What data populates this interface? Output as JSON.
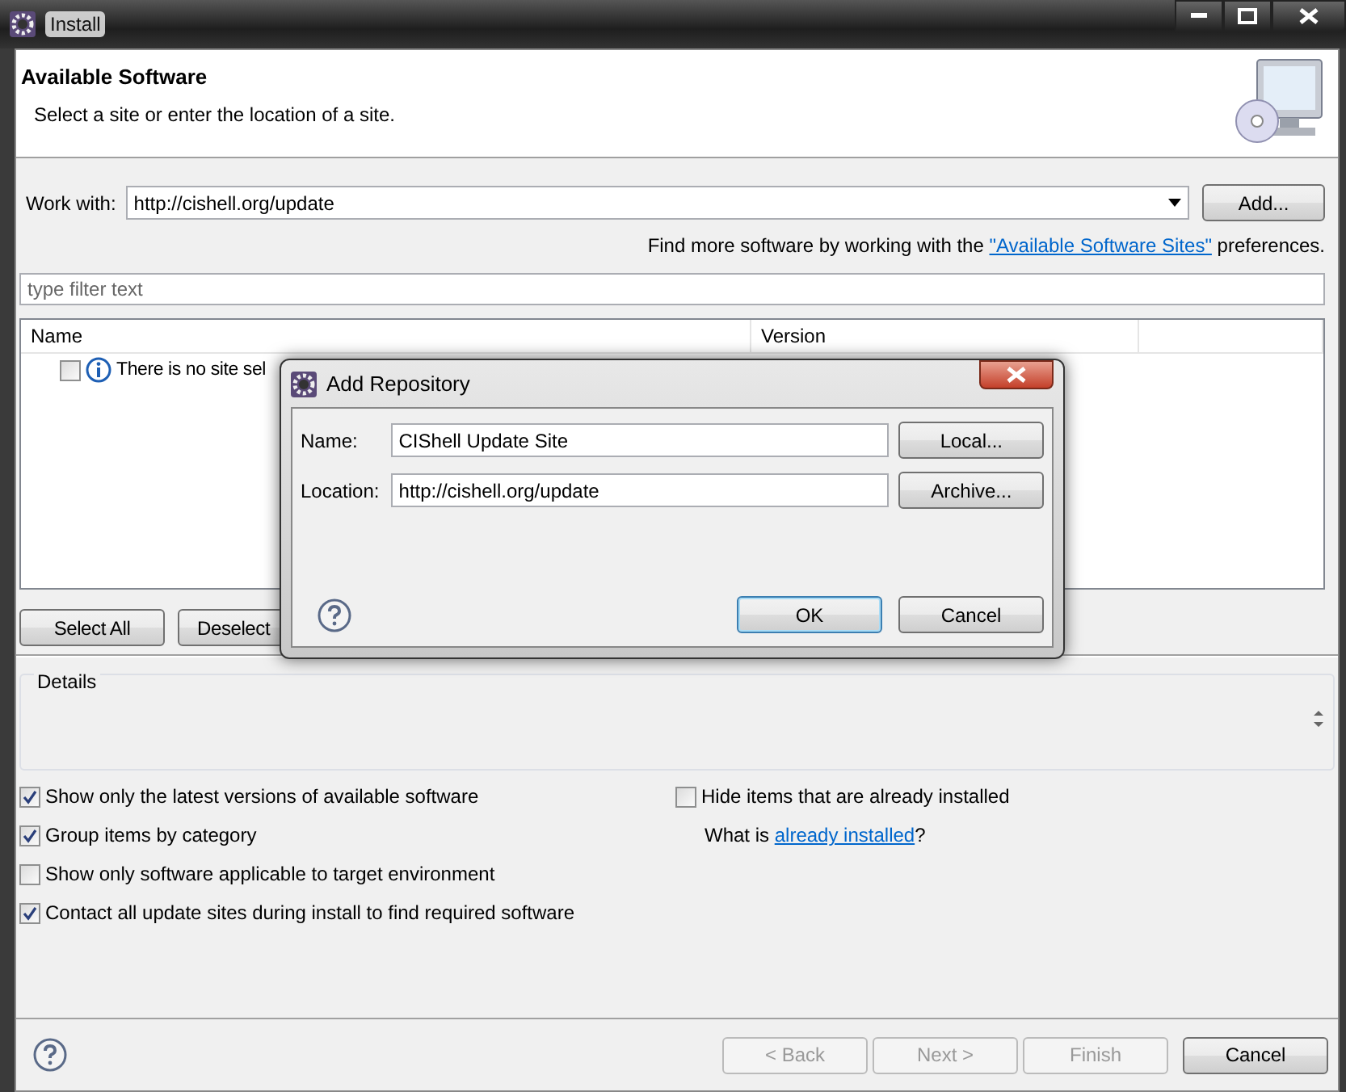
{
  "window": {
    "title": "Install"
  },
  "header": {
    "title": "Available Software",
    "subtitle": "Select a site or enter the location of a site."
  },
  "work_with": {
    "label": "Work with:",
    "value": "http://cishell.org/update",
    "add_button": "Add..."
  },
  "find_more": {
    "before": "Find more software by working with the",
    "link": "\"Available Software Sites\"",
    "after": "preferences."
  },
  "filter": {
    "placeholder": "type filter text"
  },
  "table": {
    "columns": [
      "Name",
      "Version"
    ],
    "rows": [
      {
        "text": "There is no site sel",
        "checked": false
      }
    ]
  },
  "table_buttons": [
    "Select All",
    "Deselect"
  ],
  "details": {
    "title": "Details"
  },
  "options": [
    {
      "label": "Show only the latest versions of available software",
      "checked": true
    },
    {
      "label": "Group items by category",
      "checked": true
    },
    {
      "label": "Show only software applicable to target environment",
      "checked": false
    },
    {
      "label": "Contact all update sites during install to find required software",
      "checked": true
    }
  ],
  "hide_installed": {
    "label": "Hide items that are already installed",
    "checked": false
  },
  "what_is": {
    "before": "What is",
    "link": "already installed",
    "after": "?"
  },
  "footer_buttons": [
    {
      "label": "< Back",
      "disabled": true
    },
    {
      "label": "Next >",
      "disabled": true
    },
    {
      "label": "Finish",
      "disabled": true
    },
    {
      "label": "Cancel",
      "disabled": false
    }
  ],
  "dialog": {
    "title": "Add Repository",
    "fields": [
      {
        "label": "Name:",
        "value": "CIShell Update Site",
        "button": "Local..."
      },
      {
        "label": "Location:",
        "value": "http://cishell.org/update",
        "button": "Archive..."
      }
    ],
    "buttons": [
      {
        "label": "OK",
        "default": true
      },
      {
        "label": "Cancel",
        "default": false
      }
    ]
  }
}
